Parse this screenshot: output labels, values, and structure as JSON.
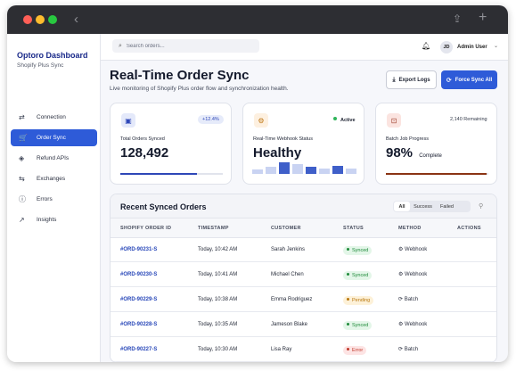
{
  "sidebar": {
    "brand": "Optoro Dashboard",
    "subtitle": "Shopify Plus Sync",
    "items": [
      {
        "label": "Connection",
        "icon": "arrows-swap-icon",
        "glyph": "⇄",
        "active": false
      },
      {
        "label": "Order Sync",
        "icon": "cart-icon",
        "glyph": "🛒",
        "active": true
      },
      {
        "label": "Refund APIs",
        "icon": "diamond-icon",
        "glyph": "◈",
        "active": false
      },
      {
        "label": "Exchanges",
        "icon": "exchange-icon",
        "glyph": "⇆",
        "active": false
      },
      {
        "label": "Errors",
        "icon": "alert-circle-icon",
        "glyph": "ⓘ",
        "active": false
      },
      {
        "label": "Insights",
        "icon": "trend-icon",
        "glyph": "↗",
        "active": false
      }
    ]
  },
  "topbar": {
    "search_placeholder": "Search orders...",
    "avatar_initials": "JD",
    "user_name": "Admin User"
  },
  "header": {
    "title": "Real-Time Order Sync",
    "subtitle": "Live monitoring of Shopify Plus order flow and synchronization health.",
    "export_label": "Export Logs",
    "sync_label": "Force Sync All"
  },
  "cards": {
    "orders_synced": {
      "label": "Total Orders Synced",
      "value": "128,492",
      "badge": "+12.4%",
      "progress": 0.75
    },
    "webhook": {
      "label": "Real-Time Webhook Status",
      "value": "Healthy",
      "badge": "Active",
      "bars": [
        0.35,
        0.55,
        0.9,
        0.75,
        0.6,
        0.4,
        0.65,
        0.45
      ]
    },
    "batch": {
      "label": "Batch Job Progress",
      "value": "98%",
      "value_suffix": "Complete",
      "remaining": "2,140 Remaining",
      "progress": 0.98
    }
  },
  "orders": {
    "title": "Recent Synced Orders",
    "filters": [
      "All",
      "Success",
      "Failed"
    ],
    "active_filter": "All",
    "columns": [
      "SHOPIFY ORDER ID",
      "TIMESTAMP",
      "CUSTOMER",
      "STATUS",
      "METHOD",
      "ACTIONS"
    ],
    "rows": [
      {
        "id": "#ORD-90231-S",
        "time": "Today, 10:42 AM",
        "customer": "Sarah Jenkins",
        "status": "Synced",
        "method": "Webhook"
      },
      {
        "id": "#ORD-90230-S",
        "time": "Today, 10:41 AM",
        "customer": "Michael Chen",
        "status": "Synced",
        "method": "Webhook"
      },
      {
        "id": "#ORD-90229-S",
        "time": "Today, 10:38 AM",
        "customer": "Emma Rodriguez",
        "status": "Pending",
        "method": "Batch"
      },
      {
        "id": "#ORD-90228-S",
        "time": "Today, 10:35 AM",
        "customer": "Jameson Blake",
        "status": "Synced",
        "method": "Webhook"
      },
      {
        "id": "#ORD-90227-S",
        "time": "Today, 10:30 AM",
        "customer": "Lisa Ray",
        "status": "Error",
        "method": "Batch"
      }
    ]
  },
  "colors": {
    "accent": "#2e5bd8",
    "synced_bg": "#e3f6e8",
    "synced_fg": "#1f8a3a",
    "pending_bg": "#fdf1d8",
    "pending_fg": "#b9770e",
    "error_bg": "#fde4e4",
    "error_fg": "#c0392b"
  }
}
